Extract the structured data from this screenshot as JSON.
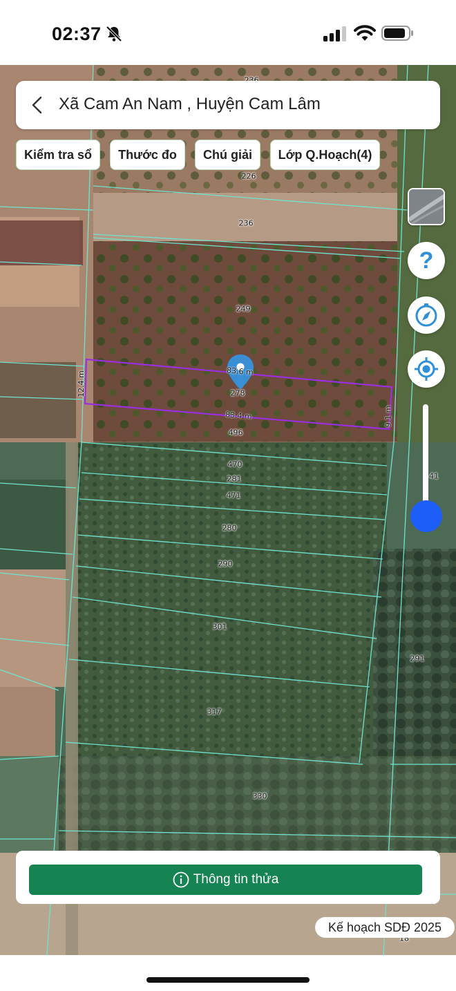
{
  "status_bar": {
    "time": "02:37"
  },
  "header": {
    "title": "Xã Cam An Nam , Huyện Cam Lâm"
  },
  "chips": [
    {
      "label": "Kiểm tra sổ"
    },
    {
      "label": "Thước đo"
    },
    {
      "label": "Chú giải"
    },
    {
      "label": "Lớp Q.Hoạch(4)"
    }
  ],
  "map": {
    "parcels": [
      "236",
      "226",
      "236",
      "249",
      "278",
      "496",
      "470",
      "281",
      "471",
      "280",
      "290",
      "301",
      "291",
      "317",
      "330",
      "41",
      "18"
    ],
    "measurements": {
      "top": "83.6 m",
      "bottom": "83.4 m",
      "left": "12.4 m",
      "right": "9.1 m"
    },
    "highlight_color": "#9b2fe0",
    "parcel_line_color": "#6fe3cf"
  },
  "controls": {
    "help": "?"
  },
  "info_card": {
    "button_label": "Thông tin thửa",
    "button_color": "#168352"
  },
  "plan_badge": "Kế hoạch SDĐ 2025"
}
